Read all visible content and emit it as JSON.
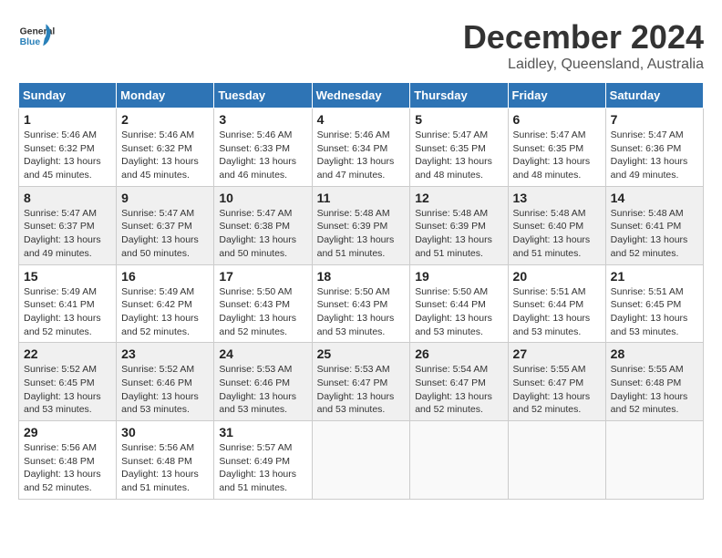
{
  "logo": {
    "text_general": "General",
    "text_blue": "Blue"
  },
  "title": {
    "month": "December 2024",
    "location": "Laidley, Queensland, Australia"
  },
  "headers": [
    "Sunday",
    "Monday",
    "Tuesday",
    "Wednesday",
    "Thursday",
    "Friday",
    "Saturday"
  ],
  "weeks": [
    [
      {
        "day": "1",
        "sunrise": "5:46 AM",
        "sunset": "6:32 PM",
        "daylight": "13 hours and 45 minutes."
      },
      {
        "day": "2",
        "sunrise": "5:46 AM",
        "sunset": "6:32 PM",
        "daylight": "13 hours and 45 minutes."
      },
      {
        "day": "3",
        "sunrise": "5:46 AM",
        "sunset": "6:33 PM",
        "daylight": "13 hours and 46 minutes."
      },
      {
        "day": "4",
        "sunrise": "5:46 AM",
        "sunset": "6:34 PM",
        "daylight": "13 hours and 47 minutes."
      },
      {
        "day": "5",
        "sunrise": "5:47 AM",
        "sunset": "6:35 PM",
        "daylight": "13 hours and 48 minutes."
      },
      {
        "day": "6",
        "sunrise": "5:47 AM",
        "sunset": "6:35 PM",
        "daylight": "13 hours and 48 minutes."
      },
      {
        "day": "7",
        "sunrise": "5:47 AM",
        "sunset": "6:36 PM",
        "daylight": "13 hours and 49 minutes."
      }
    ],
    [
      {
        "day": "8",
        "sunrise": "5:47 AM",
        "sunset": "6:37 PM",
        "daylight": "13 hours and 49 minutes."
      },
      {
        "day": "9",
        "sunrise": "5:47 AM",
        "sunset": "6:37 PM",
        "daylight": "13 hours and 50 minutes."
      },
      {
        "day": "10",
        "sunrise": "5:47 AM",
        "sunset": "6:38 PM",
        "daylight": "13 hours and 50 minutes."
      },
      {
        "day": "11",
        "sunrise": "5:48 AM",
        "sunset": "6:39 PM",
        "daylight": "13 hours and 51 minutes."
      },
      {
        "day": "12",
        "sunrise": "5:48 AM",
        "sunset": "6:39 PM",
        "daylight": "13 hours and 51 minutes."
      },
      {
        "day": "13",
        "sunrise": "5:48 AM",
        "sunset": "6:40 PM",
        "daylight": "13 hours and 51 minutes."
      },
      {
        "day": "14",
        "sunrise": "5:48 AM",
        "sunset": "6:41 PM",
        "daylight": "13 hours and 52 minutes."
      }
    ],
    [
      {
        "day": "15",
        "sunrise": "5:49 AM",
        "sunset": "6:41 PM",
        "daylight": "13 hours and 52 minutes."
      },
      {
        "day": "16",
        "sunrise": "5:49 AM",
        "sunset": "6:42 PM",
        "daylight": "13 hours and 52 minutes."
      },
      {
        "day": "17",
        "sunrise": "5:50 AM",
        "sunset": "6:43 PM",
        "daylight": "13 hours and 52 minutes."
      },
      {
        "day": "18",
        "sunrise": "5:50 AM",
        "sunset": "6:43 PM",
        "daylight": "13 hours and 53 minutes."
      },
      {
        "day": "19",
        "sunrise": "5:50 AM",
        "sunset": "6:44 PM",
        "daylight": "13 hours and 53 minutes."
      },
      {
        "day": "20",
        "sunrise": "5:51 AM",
        "sunset": "6:44 PM",
        "daylight": "13 hours and 53 minutes."
      },
      {
        "day": "21",
        "sunrise": "5:51 AM",
        "sunset": "6:45 PM",
        "daylight": "13 hours and 53 minutes."
      }
    ],
    [
      {
        "day": "22",
        "sunrise": "5:52 AM",
        "sunset": "6:45 PM",
        "daylight": "13 hours and 53 minutes."
      },
      {
        "day": "23",
        "sunrise": "5:52 AM",
        "sunset": "6:46 PM",
        "daylight": "13 hours and 53 minutes."
      },
      {
        "day": "24",
        "sunrise": "5:53 AM",
        "sunset": "6:46 PM",
        "daylight": "13 hours and 53 minutes."
      },
      {
        "day": "25",
        "sunrise": "5:53 AM",
        "sunset": "6:47 PM",
        "daylight": "13 hours and 53 minutes."
      },
      {
        "day": "26",
        "sunrise": "5:54 AM",
        "sunset": "6:47 PM",
        "daylight": "13 hours and 52 minutes."
      },
      {
        "day": "27",
        "sunrise": "5:55 AM",
        "sunset": "6:47 PM",
        "daylight": "13 hours and 52 minutes."
      },
      {
        "day": "28",
        "sunrise": "5:55 AM",
        "sunset": "6:48 PM",
        "daylight": "13 hours and 52 minutes."
      }
    ],
    [
      {
        "day": "29",
        "sunrise": "5:56 AM",
        "sunset": "6:48 PM",
        "daylight": "13 hours and 52 minutes."
      },
      {
        "day": "30",
        "sunrise": "5:56 AM",
        "sunset": "6:48 PM",
        "daylight": "13 hours and 51 minutes."
      },
      {
        "day": "31",
        "sunrise": "5:57 AM",
        "sunset": "6:49 PM",
        "daylight": "13 hours and 51 minutes."
      },
      null,
      null,
      null,
      null
    ]
  ]
}
